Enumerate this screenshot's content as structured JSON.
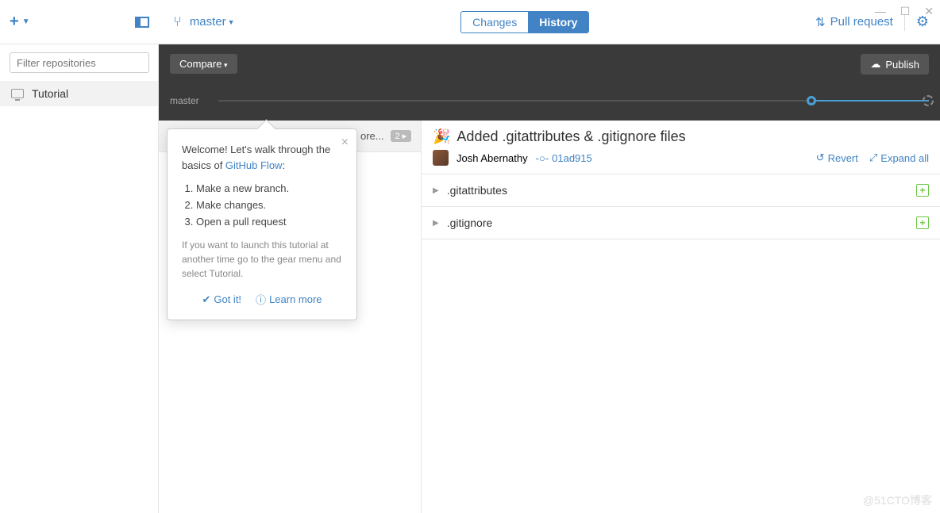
{
  "window": {
    "minimize": "—",
    "maximize": "☐",
    "close": "✕"
  },
  "sidebar": {
    "filter_placeholder": "Filter repositories",
    "repo": "Tutorial"
  },
  "topbar": {
    "branch": "master",
    "tabs": {
      "changes": "Changes",
      "history": "History"
    },
    "pull_request": "Pull request"
  },
  "dark": {
    "compare": "Compare",
    "publish": "Publish",
    "timeline_label": "master"
  },
  "commit_row": {
    "partial": "ore...",
    "badge": "2 ▸"
  },
  "commit": {
    "emoji": "🎉",
    "title": "Added .gitattributes & .gitignore files",
    "author": "Josh Abernathy",
    "sha": "01ad915",
    "revert": "Revert",
    "expand": "Expand all",
    "files": [
      ".gitattributes",
      ".gitignore"
    ]
  },
  "popover": {
    "intro_a": "Welcome! Let's walk through the basics of ",
    "intro_link": "GitHub Flow",
    "steps": [
      "Make a new branch.",
      "Make changes.",
      "Open a pull request"
    ],
    "hint": "If you want to launch this tutorial at another time go to the gear menu and select Tutorial.",
    "gotit": "Got it!",
    "learn": "Learn more"
  },
  "watermark": "@51CTO博客"
}
